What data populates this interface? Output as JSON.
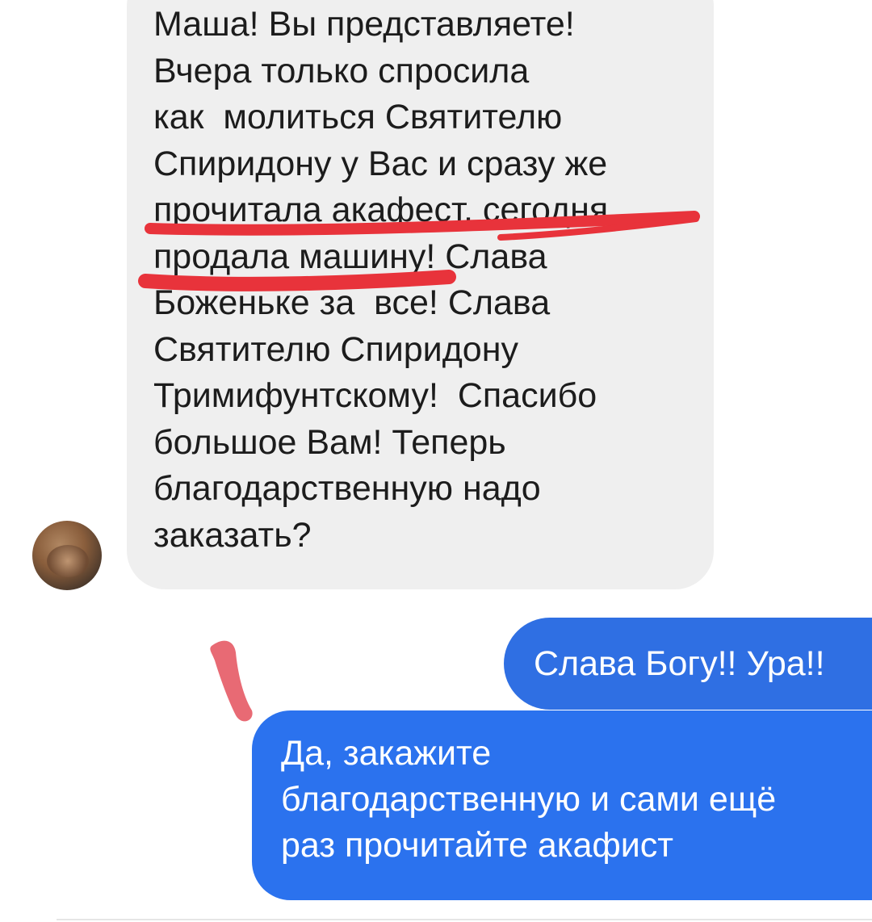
{
  "conversation": {
    "incoming": {
      "lines": [
        "Маша! Вы представляете!",
        "Вчера только спросила",
        "как  молиться Святителю",
        "Спиридону у Вас и сразу же",
        "прочитала акафест, сегодня",
        "продала машину! Слава",
        "Боженьке за  все! Слава",
        "Святителю Спиридону",
        "Тримифунтскому!  Спасибо",
        "большое Вам! Теперь",
        "благодарственную надо",
        "заказать?"
      ]
    },
    "outgoing": [
      {
        "lines": [
          "Слава Богу!! Ура!!"
        ]
      },
      {
        "lines": [
          "Да, закажите",
          "благодарственную и сами ещё",
          "раз прочитайте акафист"
        ]
      }
    ]
  },
  "colors": {
    "incoming_bubble": "#efefef",
    "outgoing_bubble_1": "#2f6fe3",
    "outgoing_bubble_2": "#2b72ee",
    "annotation_marker": "#e8333b",
    "annotation_mark_bottom": "#e86a74"
  },
  "icons": {
    "avatar": "avatar-photo-cat"
  }
}
